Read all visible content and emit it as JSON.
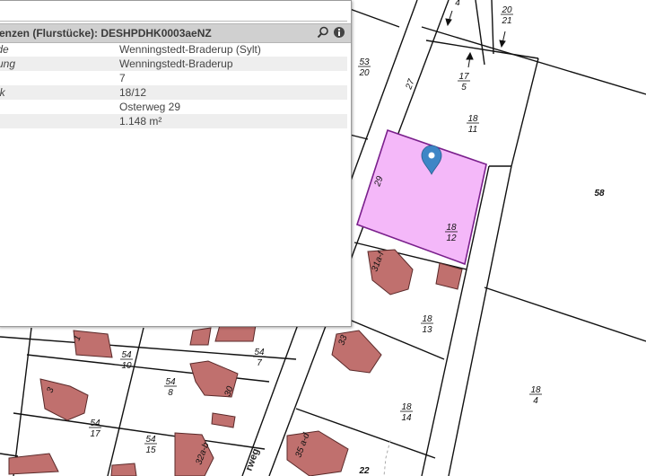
{
  "map": {
    "parcel_labels": [
      {
        "num": "4",
        "den": ""
      },
      {
        "num": "20",
        "den": "21"
      },
      {
        "num": "53",
        "den": "20"
      },
      {
        "num": "17",
        "den": "5"
      },
      {
        "num": "18",
        "den": "11"
      },
      {
        "num": "18",
        "den": "12"
      },
      {
        "num": "18",
        "den": "13"
      },
      {
        "num": "18",
        "den": "14"
      },
      {
        "num": "18",
        "den": "4"
      },
      {
        "num": "54",
        "den": "10"
      },
      {
        "num": "54",
        "den": "7"
      },
      {
        "num": "54",
        "den": "8"
      },
      {
        "num": "54",
        "den": "17"
      },
      {
        "num": "54",
        "den": "15"
      }
    ],
    "single_labels": [
      "58",
      "22"
    ],
    "house_numbers": [
      "27",
      "29",
      "31a-f",
      "33",
      "35 a-d",
      "1",
      "3",
      "30",
      "32a-b"
    ],
    "street_fragment": "rweg",
    "marker_icon": "map-pin-icon",
    "colors": {
      "highlight_fill": "#f4b8f9",
      "highlight_stroke": "#7a1f8c",
      "building_fill": "#c0706e",
      "marker": "#3e86c6"
    }
  },
  "panel": {
    "title": "enzen (Flurstücke): DESHPDHK0003aeNZ",
    "icons": [
      "search-icon",
      "info-icon"
    ],
    "rows": [
      {
        "key": "inde",
        "value": "Wenningstedt-Braderup (Sylt)"
      },
      {
        "key": "rkung",
        "value": "Wenningstedt-Braderup"
      },
      {
        "key": "",
        "value": "7"
      },
      {
        "key": "ück",
        "value": "18/12"
      },
      {
        "key": "",
        "value": "Osterweg 29"
      },
      {
        "key": "",
        "value": "1.148 m²"
      }
    ]
  }
}
